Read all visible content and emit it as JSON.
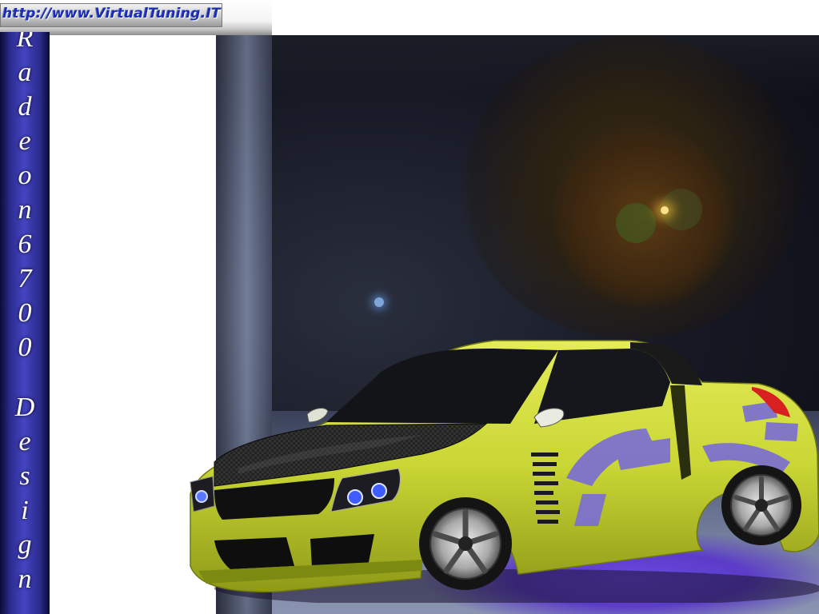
{
  "banner": {
    "url_text": "http://www.VirtualTuning.IT"
  },
  "sidebar": {
    "letters": [
      "R",
      "a",
      "d",
      "e",
      "o",
      "n",
      "6",
      "7",
      "0",
      "0",
      "D",
      "e",
      "s",
      "i",
      "g",
      "n"
    ]
  },
  "colors": {
    "car_body": "#cfdc3a",
    "underglow": "#6a48e0",
    "sidebar_blue": "#3a3ab0"
  }
}
